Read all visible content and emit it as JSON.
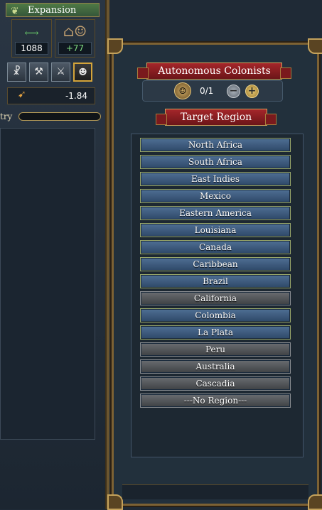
{
  "expansion": {
    "title": "Expansion",
    "colonial_range": "1088",
    "settler_growth": "+77",
    "tariff_value": "-1.84",
    "country_label": "try"
  },
  "colonists": {
    "title": "Autonomous Colonists",
    "count": "0/1"
  },
  "target": {
    "title": "Target Region",
    "regions": [
      {
        "label": "North Africa",
        "state": "available"
      },
      {
        "label": "South Africa",
        "state": "available"
      },
      {
        "label": "East Indies",
        "state": "available"
      },
      {
        "label": "Mexico",
        "state": "available"
      },
      {
        "label": "Eastern America",
        "state": "available"
      },
      {
        "label": "Louisiana",
        "state": "available"
      },
      {
        "label": "Canada",
        "state": "available"
      },
      {
        "label": "Caribbean",
        "state": "available"
      },
      {
        "label": "Brazil",
        "state": "available"
      },
      {
        "label": "California",
        "state": "unavailable"
      },
      {
        "label": "Colombia",
        "state": "available"
      },
      {
        "label": "La Plata",
        "state": "available"
      },
      {
        "label": "Peru",
        "state": "unavailable"
      },
      {
        "label": "Australia",
        "state": "unavailable"
      },
      {
        "label": "Cascadia",
        "state": "unavailable"
      },
      {
        "label": "---No Region---",
        "state": "unavailable"
      }
    ]
  },
  "colors": {
    "available_button": "#3f5f84",
    "unavailable_button": "#55585c",
    "banner_red": "#8e1f22",
    "frame_gold": "#7d6234",
    "positive_green": "#7ed87e"
  },
  "icons": {
    "expansion": "leaf-icon",
    "range": "house-arrow-icon",
    "growth": "settlers-icon",
    "tariff": "coin-arrow-icon",
    "colonist": "colonist-portrait-icon"
  }
}
